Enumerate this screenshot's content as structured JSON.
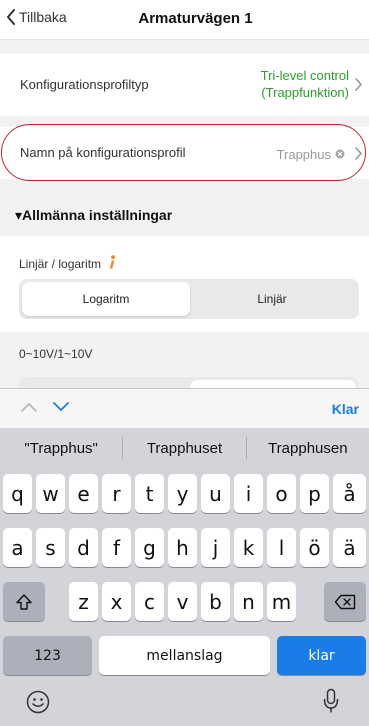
{
  "navbar": {
    "back_label": "Tillbaka",
    "title": "Armaturvägen 1"
  },
  "rows": {
    "profile_type": {
      "label": "Konfigurationsprofiltyp",
      "value_line1": "Tri-level control",
      "value_line2": "(Trappfunktion)"
    },
    "profile_name": {
      "label": "Namn på konfigurationsprofil",
      "value": "Trapphus"
    }
  },
  "section": {
    "title": "▾Allmänna inställningar"
  },
  "linear_log": {
    "label": "Linjär / logaritm",
    "options": [
      "Logaritm",
      "Linjär"
    ],
    "selected": "Logaritm"
  },
  "voltage": {
    "label": "0~10V/1~10V"
  },
  "keyboard": {
    "done_label": "Klar",
    "suggestions": [
      "\"Trapphus\"",
      "Trapphuset",
      "Trapphusen"
    ],
    "row1": [
      "q",
      "w",
      "e",
      "r",
      "t",
      "y",
      "u",
      "i",
      "o",
      "p",
      "å"
    ],
    "row2": [
      "a",
      "s",
      "d",
      "f",
      "g",
      "h",
      "j",
      "k",
      "l",
      "ö",
      "ä"
    ],
    "row3": [
      "z",
      "x",
      "c",
      "v",
      "b",
      "n",
      "m"
    ],
    "numbers_label": "123",
    "space_label": "mellanslag",
    "return_label": "klar"
  },
  "colors": {
    "accent_green": "#2aa12a",
    "accent_blue": "#1a7ce6",
    "highlight_red": "#c8232c",
    "info_orange": "#f08a1c"
  }
}
